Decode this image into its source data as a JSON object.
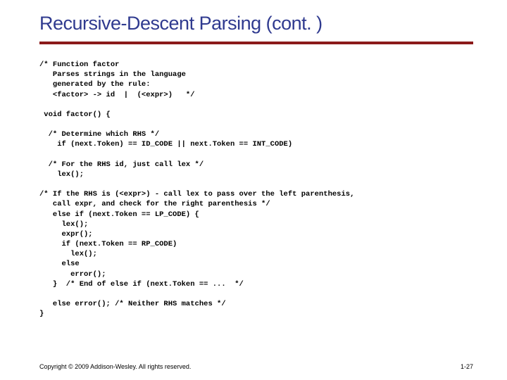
{
  "title": "Recursive-Descent Parsing (cont. )",
  "code": "/* Function factor\n   Parses strings in the language\n   generated by the rule:\n   <factor> -> id  |  (<expr>)   */\n\n void factor() {\n\n  /* Determine which RHS */\n    if (next.Token) == ID_CODE || next.Token == INT_CODE)\n\n  /* For the RHS id, just call lex */\n    lex();\n\n/* If the RHS is (<expr>) - call lex to pass over the left parenthesis,\n   call expr, and check for the right parenthesis */\n   else if (next.Token == LP_CODE) {\n     lex();\n     expr();\n     if (next.Token == RP_CODE)\n       lex();\n     else\n       error();\n   }  /* End of else if (next.Token == ...  */\n\n   else error(); /* Neither RHS matches */\n}",
  "footer": {
    "copyright": "Copyright © 2009 Addison-Wesley. All rights reserved.",
    "page": "1-27"
  }
}
